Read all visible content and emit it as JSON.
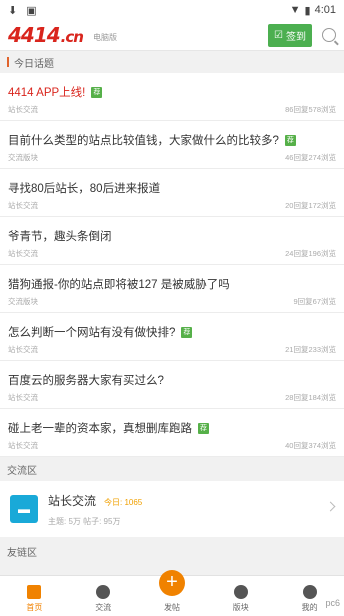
{
  "status": {
    "time": "4:01",
    "left_icons": [
      "download-icon",
      "image-icon"
    ]
  },
  "header": {
    "logo_main": "4414",
    "logo_suffix": ".cn",
    "subtitle": "电脑版",
    "checkin": "签到"
  },
  "today": {
    "title": "今日话题",
    "items": [
      {
        "title": "4414 APP上线!",
        "tag": "荐",
        "board": "站长交流",
        "stats": "86回复578浏览",
        "highlight": true
      },
      {
        "title": "目前什么类型的站点比较值钱，大家做什么的比较多?",
        "tag": "荐",
        "board": "交流版块",
        "stats": "46回复274浏览",
        "highlight": false
      },
      {
        "title": "寻找80后站长，80后进来报道",
        "tag": "",
        "board": "站长交流",
        "stats": "20回复172浏览",
        "highlight": false
      },
      {
        "title": "爷青节，趣头条倒闭",
        "tag": "",
        "board": "站长交流",
        "stats": "24回复196浏览",
        "highlight": false
      },
      {
        "title": "猎狗通报-你的站点即将被127 是被威胁了吗",
        "tag": "",
        "board": "交流版块",
        "stats": "9回复67浏览",
        "highlight": false
      },
      {
        "title": "怎么判断一个网站有没有做快排?",
        "tag": "荐",
        "board": "站长交流",
        "stats": "21回复233浏览",
        "highlight": false
      },
      {
        "title": "百度云的服务器大家有买过么?",
        "tag": "",
        "board": "站长交流",
        "stats": "28回复184浏览",
        "highlight": false
      },
      {
        "title": "碰上老一辈的资本家，真想删库跑路",
        "tag": "荐",
        "board": "站长交流",
        "stats": "40回复374浏览",
        "highlight": false
      }
    ]
  },
  "exchange": {
    "title": "交流区",
    "name": "站长交流",
    "today": "今日: 1065",
    "stats": "主题: 5万  帖子: 95万"
  },
  "friend": {
    "title": "友链区"
  },
  "tabs": [
    {
      "label": "首页",
      "icon": "home-icon",
      "active": true
    },
    {
      "label": "交流",
      "icon": "chat-icon",
      "active": false
    },
    {
      "label": "发帖",
      "icon": "plus-icon",
      "active": false
    },
    {
      "label": "版块",
      "icon": "board-icon",
      "active": false
    },
    {
      "label": "我的",
      "icon": "user-icon",
      "active": false
    }
  ],
  "watermark": "pc6"
}
